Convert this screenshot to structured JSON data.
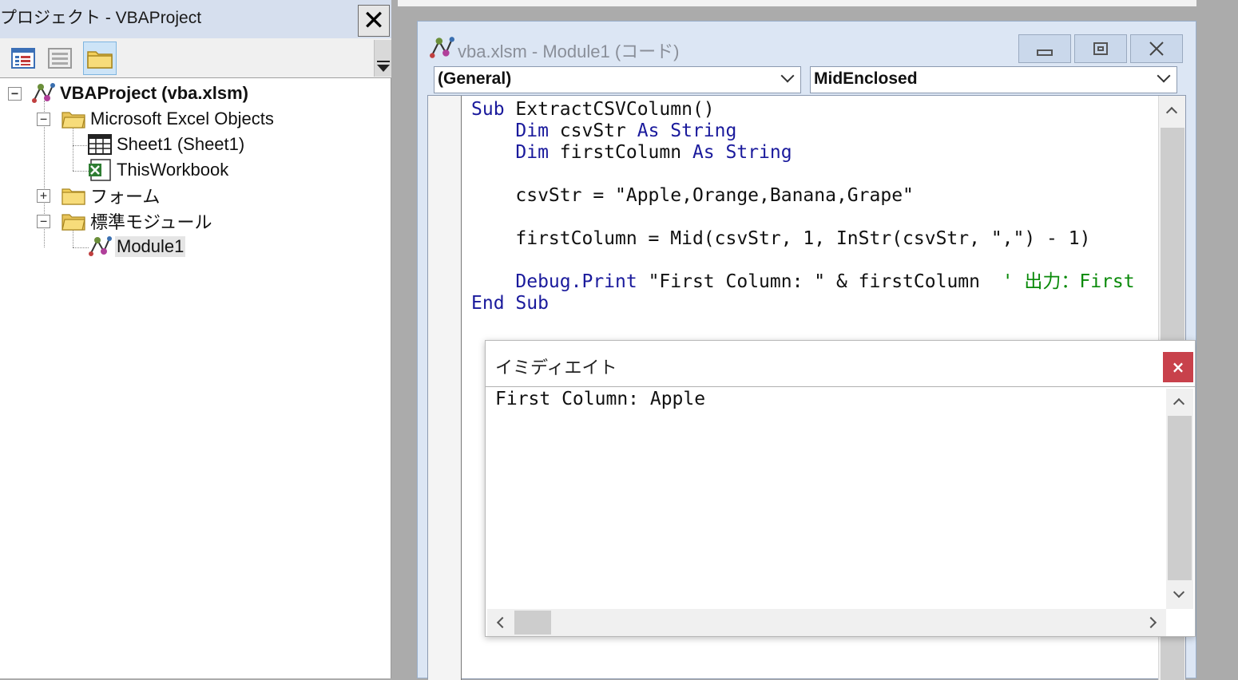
{
  "project": {
    "title": "プロジェクト - VBAProject",
    "close_glyph": "✕",
    "toolbar": [
      "view-code-icon",
      "view-object-icon",
      "toggle-folders-icon"
    ],
    "tree": [
      {
        "label": "VBAProject (vba.xlsm)",
        "expander": "−",
        "icon": "vba-project-icon"
      },
      {
        "label": "Microsoft Excel Objects",
        "expander": "−",
        "icon": "folder-open-icon"
      },
      {
        "label": "Sheet1 (Sheet1)",
        "icon": "worksheet-icon"
      },
      {
        "label": "ThisWorkbook",
        "icon": "workbook-icon"
      },
      {
        "label": "フォーム",
        "expander": "+",
        "icon": "folder-closed-icon"
      },
      {
        "label": "標準モジュール",
        "expander": "−",
        "icon": "folder-open-icon"
      },
      {
        "label": "Module1",
        "icon": "module-icon",
        "selected": true
      }
    ]
  },
  "code_window": {
    "title": "vba.xlsm - Module1 (コード)",
    "object_combo": "(General)",
    "procedure_combo": "MidEnclosed",
    "code": {
      "l1_kw": "Sub",
      "l1_name": " ExtractCSVColumn()",
      "l2_kw1": "    Dim",
      "l2_var": " csvStr ",
      "l2_kw2": "As String",
      "l3_kw1": "    Dim",
      "l3_var": " firstColumn ",
      "l3_kw2": "As String",
      "l5": "    csvStr = \"Apple,Orange,Banana,Grape\"",
      "l7": "    firstColumn = Mid(csvStr, 1, InStr(csvStr, \",\") - 1)",
      "l9_kw": "    Debug.Print",
      "l9_rest": " \"First Column: \" & firstColumn  ",
      "l9_comment": "' 出力：First",
      "l10_kw": "End Sub"
    }
  },
  "immediate": {
    "title": "イミディエイト",
    "close_glyph": "×",
    "output": "First Column: Apple"
  },
  "colors": {
    "keyword": "#1a1a9c",
    "comment": "#0a8a0a",
    "close_red": "#c8414b"
  }
}
